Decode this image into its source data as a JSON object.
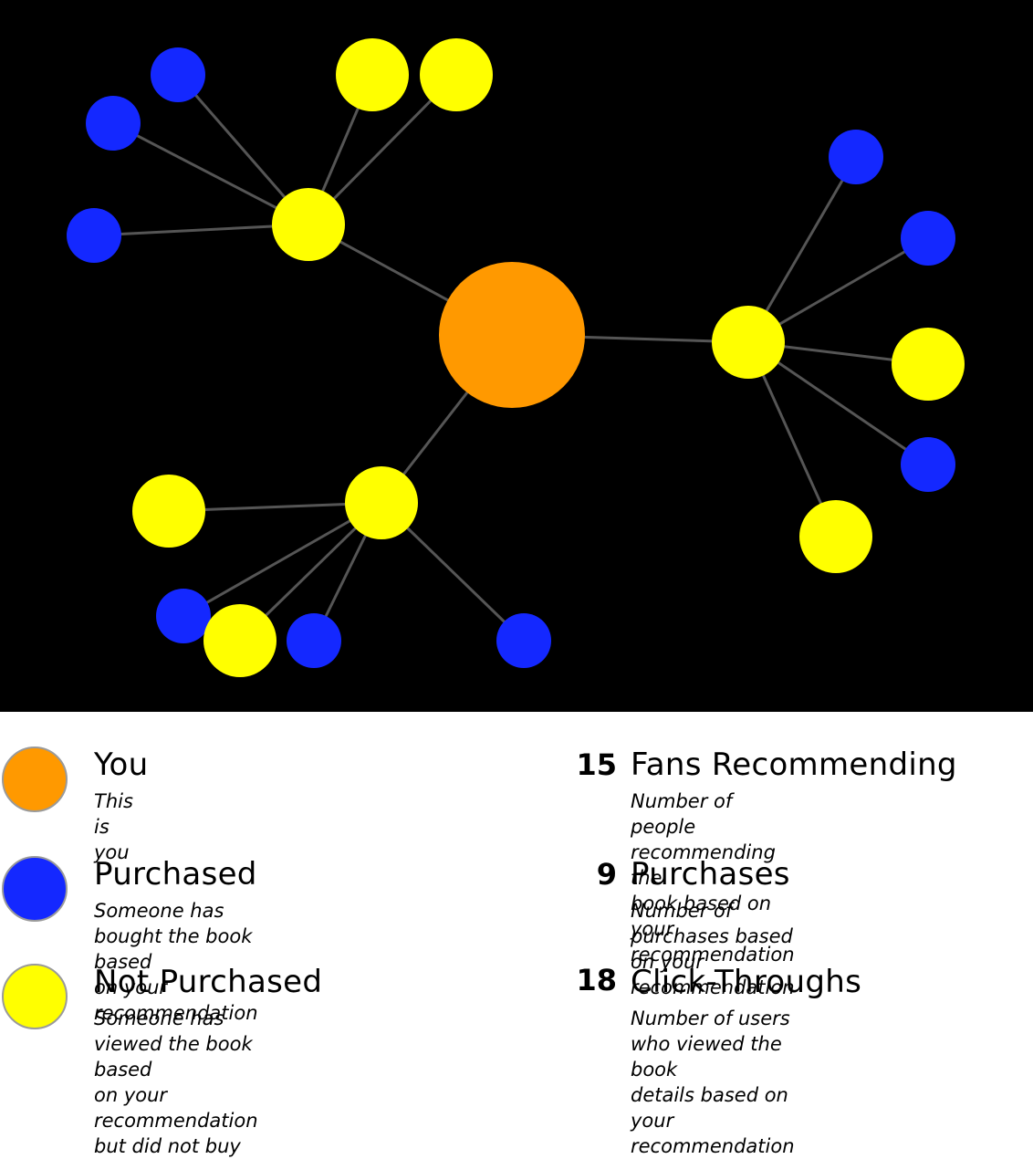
{
  "colors": {
    "background": "#000000",
    "edge": "#555555",
    "you": "#FF9900",
    "purchased": "#1428FF",
    "not_purchased": "#FFFF00"
  },
  "legend": [
    {
      "key": "you",
      "title": "You",
      "desc": "This is you",
      "color": "#FF9900"
    },
    {
      "key": "purchased",
      "title": "Purchased",
      "desc": "Someone has bought the book based\non your recommendation",
      "color": "#1428FF"
    },
    {
      "key": "not_purchased",
      "title": "Not Purchased",
      "desc": "Someone has viewed the book based\non your recommendation but did not buy",
      "color": "#FFFF00"
    }
  ],
  "stats": [
    {
      "value": "15",
      "label": "Fans Recommending",
      "desc": "Number of people recommending the\nbook based on your recommendation"
    },
    {
      "value": "9",
      "label": "Purchases",
      "desc": "Number of purchases based on your\nrecommendation"
    },
    {
      "value": "18",
      "label": "Click-Throughs",
      "desc": "Number of users who viewed the book\ndetails based on your recommendation"
    }
  ],
  "graph": {
    "root": {
      "id": "you",
      "type": "you"
    },
    "hubs": [
      {
        "id": "hub-1",
        "type": "not_purchased",
        "children": [
          "purchased",
          "purchased",
          "purchased",
          "not_purchased",
          "not_purchased"
        ]
      },
      {
        "id": "hub-2",
        "type": "not_purchased",
        "children": [
          "purchased",
          "purchased",
          "not_purchased",
          "purchased",
          "not_purchased"
        ]
      },
      {
        "id": "hub-3",
        "type": "not_purchased",
        "children": [
          "not_purchased",
          "purchased",
          "not_purchased",
          "purchased",
          "purchased"
        ]
      }
    ]
  }
}
